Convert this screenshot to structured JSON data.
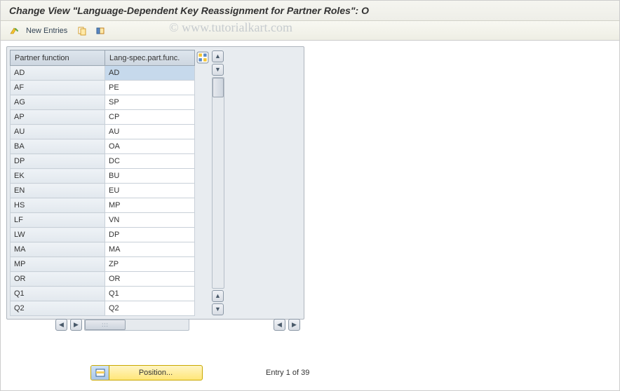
{
  "title": "Change View \"Language-Dependent Key Reassignment for Partner Roles\": O",
  "toolbar": {
    "new_entries_label": "New Entries"
  },
  "columns": {
    "col1": "Partner function",
    "col2": "Lang-spec.part.func."
  },
  "rows": [
    {
      "pf": "AD",
      "ls": "AD"
    },
    {
      "pf": "AF",
      "ls": "PE"
    },
    {
      "pf": "AG",
      "ls": "SP"
    },
    {
      "pf": "AP",
      "ls": "CP"
    },
    {
      "pf": "AU",
      "ls": "AU"
    },
    {
      "pf": "BA",
      "ls": "OA"
    },
    {
      "pf": "DP",
      "ls": "DC"
    },
    {
      "pf": "EK",
      "ls": "BU"
    },
    {
      "pf": "EN",
      "ls": "EU"
    },
    {
      "pf": "HS",
      "ls": "MP"
    },
    {
      "pf": "LF",
      "ls": "VN"
    },
    {
      "pf": "LW",
      "ls": "DP"
    },
    {
      "pf": "MA",
      "ls": "MA"
    },
    {
      "pf": "MP",
      "ls": "ZP"
    },
    {
      "pf": "OR",
      "ls": "OR"
    },
    {
      "pf": "Q1",
      "ls": "Q1"
    },
    {
      "pf": "Q2",
      "ls": "Q2"
    }
  ],
  "footer": {
    "position_label": "Position...",
    "entry_text": "Entry 1 of 39"
  },
  "watermark": "© www.tutorialkart.com"
}
